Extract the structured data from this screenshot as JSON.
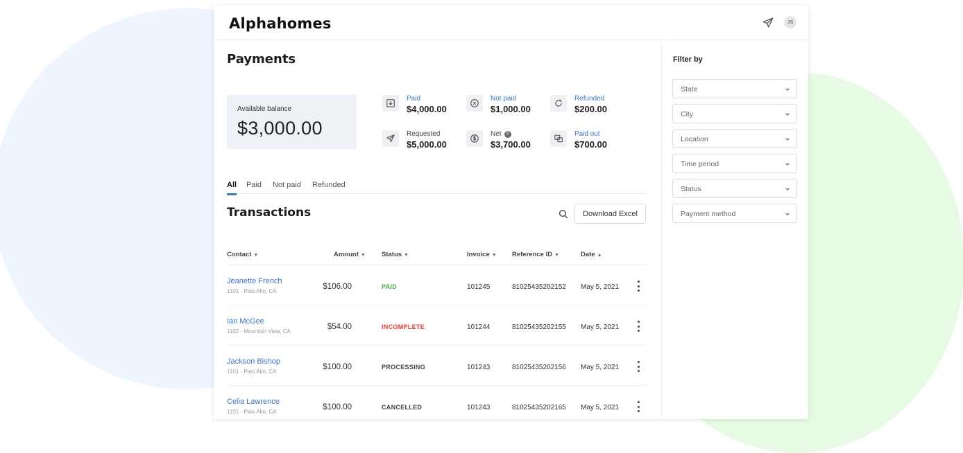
{
  "app": {
    "title": "Alphahomes",
    "avatar_initials": "JS"
  },
  "colors": {
    "accent": "#3b76c4",
    "paid": "#4caf50",
    "incomplete": "#e53935",
    "neutral": "#444444"
  },
  "payments": {
    "title": "Payments",
    "balance": {
      "label": "Available balance",
      "value": "$3,000.00"
    },
    "stats": [
      {
        "label": "Paid",
        "value": "$4,000.00",
        "icon": "download-box-icon",
        "label_style": "accent"
      },
      {
        "label": "Not paid",
        "value": "$1,000.00",
        "icon": "x-circle-icon",
        "label_style": "accent"
      },
      {
        "label": "Refunded",
        "value": "$200.00",
        "icon": "refresh-icon",
        "label_style": "accent"
      },
      {
        "label": "Requested",
        "value": "$5,000.00",
        "icon": "send-icon",
        "label_style": "dark"
      },
      {
        "label": "Net",
        "value": "$3,700.00",
        "icon": "dollar-circle-icon",
        "label_style": "dark",
        "help": "?"
      },
      {
        "label": "Paid out",
        "value": "$700.00",
        "icon": "transfer-icon",
        "label_style": "accent"
      }
    ]
  },
  "tabs": [
    "All",
    "Paid",
    "Not paid",
    "Refunded"
  ],
  "transactions": {
    "title": "Transactions",
    "download_label": "Download Excel",
    "columns": [
      "Contact",
      "Amount",
      "Status",
      "Invoice",
      "Reference ID",
      "Date"
    ],
    "rows": [
      {
        "name": "Jeanette French",
        "address": "1101 - Palo Alto, CA",
        "amount": "$106.00",
        "status": "PAID",
        "status_color": "#4caf50",
        "invoice": "101245",
        "reference": "81025435202152",
        "date": "May 5, 2021"
      },
      {
        "name": "Ian McGee",
        "address": "1102 - Mountain View, CA",
        "amount": "$54.00",
        "status": "INCOMPLETE",
        "status_color": "#e53935",
        "invoice": "101244",
        "reference": "81025435202155",
        "date": "May 5, 2021"
      },
      {
        "name": "Jackson Bishop",
        "address": "1101 - Palo Alto, CA",
        "amount": "$100.00",
        "status": "PROCESSING",
        "status_color": "#444444",
        "invoice": "101243",
        "reference": "81025435202156",
        "date": "May 5, 2021"
      },
      {
        "name": "Celia Lawrence",
        "address": "1101 - Palo Alto, CA",
        "amount": "$100.00",
        "status": "CANCELLED",
        "status_color": "#444444",
        "invoice": "101243",
        "reference": "81025435202165",
        "date": "May 5, 2021"
      }
    ]
  },
  "filters": {
    "title": "Filter by",
    "items": [
      "State",
      "City",
      "Location",
      "Time period",
      "Status",
      "Payment method"
    ]
  }
}
